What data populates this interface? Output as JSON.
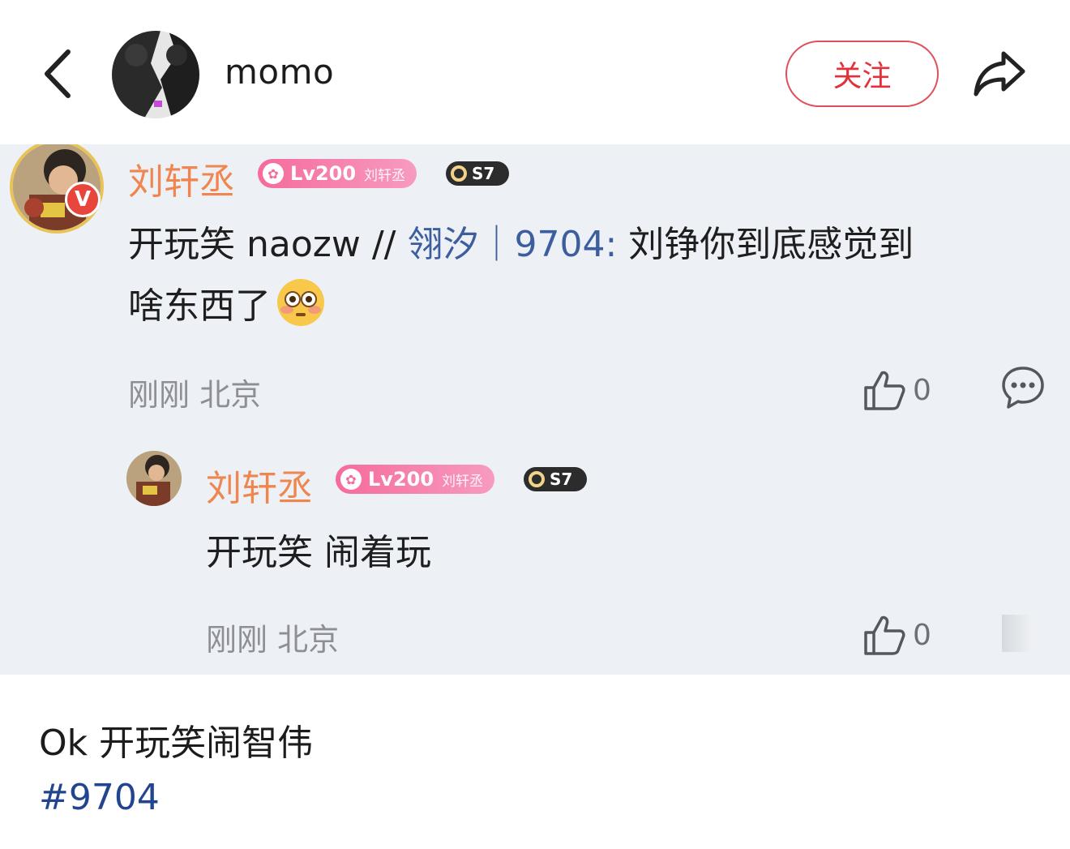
{
  "header": {
    "back_icon": "chevron-left-icon",
    "username": "momo",
    "follow_label": "关注",
    "share_icon": "share-icon"
  },
  "comment": {
    "author": "刘轩丞",
    "verified_badge": "V",
    "level_badge": {
      "level": "Lv200",
      "name": "刘轩丞"
    },
    "season_badge": "S7",
    "text_prefix": "开玩笑 naozw //",
    "mention": "翎汐｜9704:",
    "text_suffix_line1": " 刘铮你到底感觉到",
    "text_line2": "啥东西了",
    "emoji": "flushed-face-emoji",
    "time": "刚刚",
    "location": "北京",
    "likes": "0",
    "reply_icon": "comment-bubble-icon"
  },
  "reply": {
    "author": "刘轩丞",
    "level_badge": {
      "level": "Lv200",
      "name": "刘轩丞"
    },
    "season_badge": "S7",
    "text": "开玩笑 闹着玩",
    "time": "刚刚",
    "location": "北京",
    "likes": "0"
  },
  "post": {
    "caption": "Ok 开玩笑闹智伟",
    "hashtag": "#9704"
  },
  "colors": {
    "follow_red": "#e3313c",
    "name_orange": "#f0864f",
    "level_pink": "#f56b9c",
    "mention_blue": "#3c5e9e",
    "hashtag_blue": "#23448f",
    "embed_bg": "#edf0f5"
  }
}
